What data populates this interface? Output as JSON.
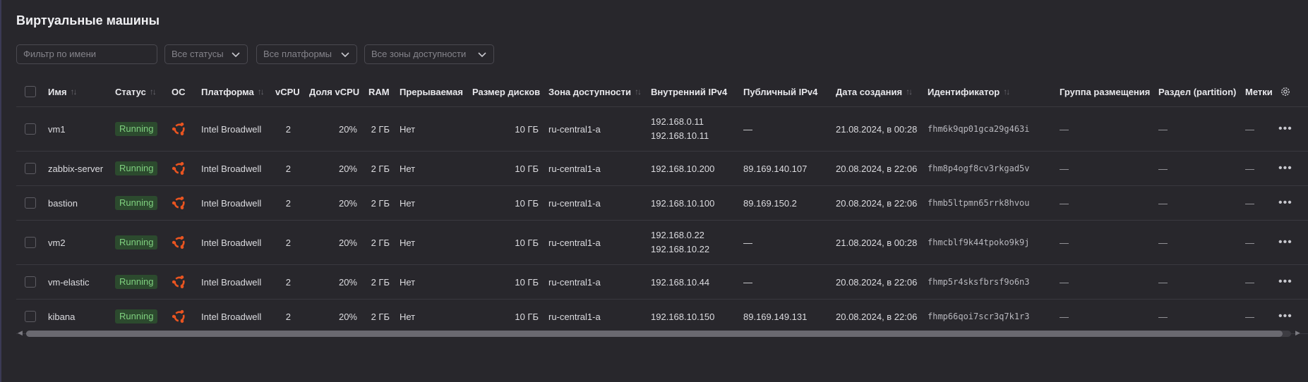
{
  "page": {
    "title": "Виртуальные машины"
  },
  "filters": {
    "name_placeholder": "Фильтр по имени",
    "status_select": "Все статусы",
    "platform_select": "Все платформы",
    "zone_select": "Все зоны доступности"
  },
  "columns": {
    "name": "Имя",
    "status": "Статус",
    "os": "ОС",
    "platform": "Платформа",
    "vcpu": "vCPU",
    "vcpu_share": "Доля vCPU",
    "ram": "RAM",
    "preemptible": "Прерываемая",
    "disk_size": "Размер дисков",
    "zone": "Зона доступности",
    "internal_ip": "Внутренний IPv4",
    "public_ip": "Публичный IPv4",
    "created": "Дата создания",
    "id": "Идентификатор",
    "placement_group": "Группа размещения",
    "partition": "Раздел (partition)",
    "labels": "Метки"
  },
  "rows": [
    {
      "name": "vm1",
      "status": "Running",
      "os_icon": "ubuntu-icon",
      "platform": "Intel Broadwell",
      "vcpu": "2",
      "vcpu_share": "20%",
      "ram": "2 ГБ",
      "preemptible": "Нет",
      "disk": "10 ГБ",
      "zone": "ru-central1-a",
      "ip_internal": [
        "192.168.0.11",
        "192.168.10.11"
      ],
      "ip_public": "—",
      "created": "21.08.2024, в 00:28",
      "id": "fhm6k9qp01gca29g463i",
      "placement_group": "—",
      "partition": "—",
      "labels": "—"
    },
    {
      "name": "zabbix-server",
      "status": "Running",
      "os_icon": "ubuntu-icon",
      "platform": "Intel Broadwell",
      "vcpu": "2",
      "vcpu_share": "20%",
      "ram": "2 ГБ",
      "preemptible": "Нет",
      "disk": "10 ГБ",
      "zone": "ru-central1-a",
      "ip_internal": [
        "192.168.10.200"
      ],
      "ip_public": "89.169.140.107",
      "created": "20.08.2024, в 22:06",
      "id": "fhm8p4ogf8cv3rkgad5v",
      "placement_group": "—",
      "partition": "—",
      "labels": "—"
    },
    {
      "name": "bastion",
      "status": "Running",
      "os_icon": "ubuntu-icon",
      "platform": "Intel Broadwell",
      "vcpu": "2",
      "vcpu_share": "20%",
      "ram": "2 ГБ",
      "preemptible": "Нет",
      "disk": "10 ГБ",
      "zone": "ru-central1-a",
      "ip_internal": [
        "192.168.10.100"
      ],
      "ip_public": "89.169.150.2",
      "created": "20.08.2024, в 22:06",
      "id": "fhmb5ltpmn65rrk8hvou",
      "placement_group": "—",
      "partition": "—",
      "labels": "—"
    },
    {
      "name": "vm2",
      "status": "Running",
      "os_icon": "ubuntu-icon",
      "platform": "Intel Broadwell",
      "vcpu": "2",
      "vcpu_share": "20%",
      "ram": "2 ГБ",
      "preemptible": "Нет",
      "disk": "10 ГБ",
      "zone": "ru-central1-a",
      "ip_internal": [
        "192.168.0.22",
        "192.168.10.22"
      ],
      "ip_public": "—",
      "created": "21.08.2024, в 00:28",
      "id": "fhmcblf9k44tpoko9k9j",
      "placement_group": "—",
      "partition": "—",
      "labels": "—"
    },
    {
      "name": "vm-elastic",
      "status": "Running",
      "os_icon": "ubuntu-icon",
      "platform": "Intel Broadwell",
      "vcpu": "2",
      "vcpu_share": "20%",
      "ram": "2 ГБ",
      "preemptible": "Нет",
      "disk": "10 ГБ",
      "zone": "ru-central1-a",
      "ip_internal": [
        "192.168.10.44"
      ],
      "ip_public": "—",
      "created": "20.08.2024, в 22:06",
      "id": "fhmp5r4sksfbrsf9o6n3",
      "placement_group": "—",
      "partition": "—",
      "labels": "—"
    },
    {
      "name": "kibana",
      "status": "Running",
      "os_icon": "ubuntu-icon",
      "platform": "Intel Broadwell",
      "vcpu": "2",
      "vcpu_share": "20%",
      "ram": "2 ГБ",
      "preemptible": "Нет",
      "disk": "10 ГБ",
      "zone": "ru-central1-a",
      "ip_internal": [
        "192.168.10.150"
      ],
      "ip_public": "89.169.149.131",
      "created": "20.08.2024, в 22:06",
      "id": "fhmp66qoi7scr3q7k1r3",
      "placement_group": "—",
      "partition": "—",
      "labels": "—"
    }
  ],
  "colors": {
    "background": "#28272c",
    "running_bg": "#2c4a2e",
    "running_text": "#7fd07f",
    "ubuntu": "#e95420"
  }
}
